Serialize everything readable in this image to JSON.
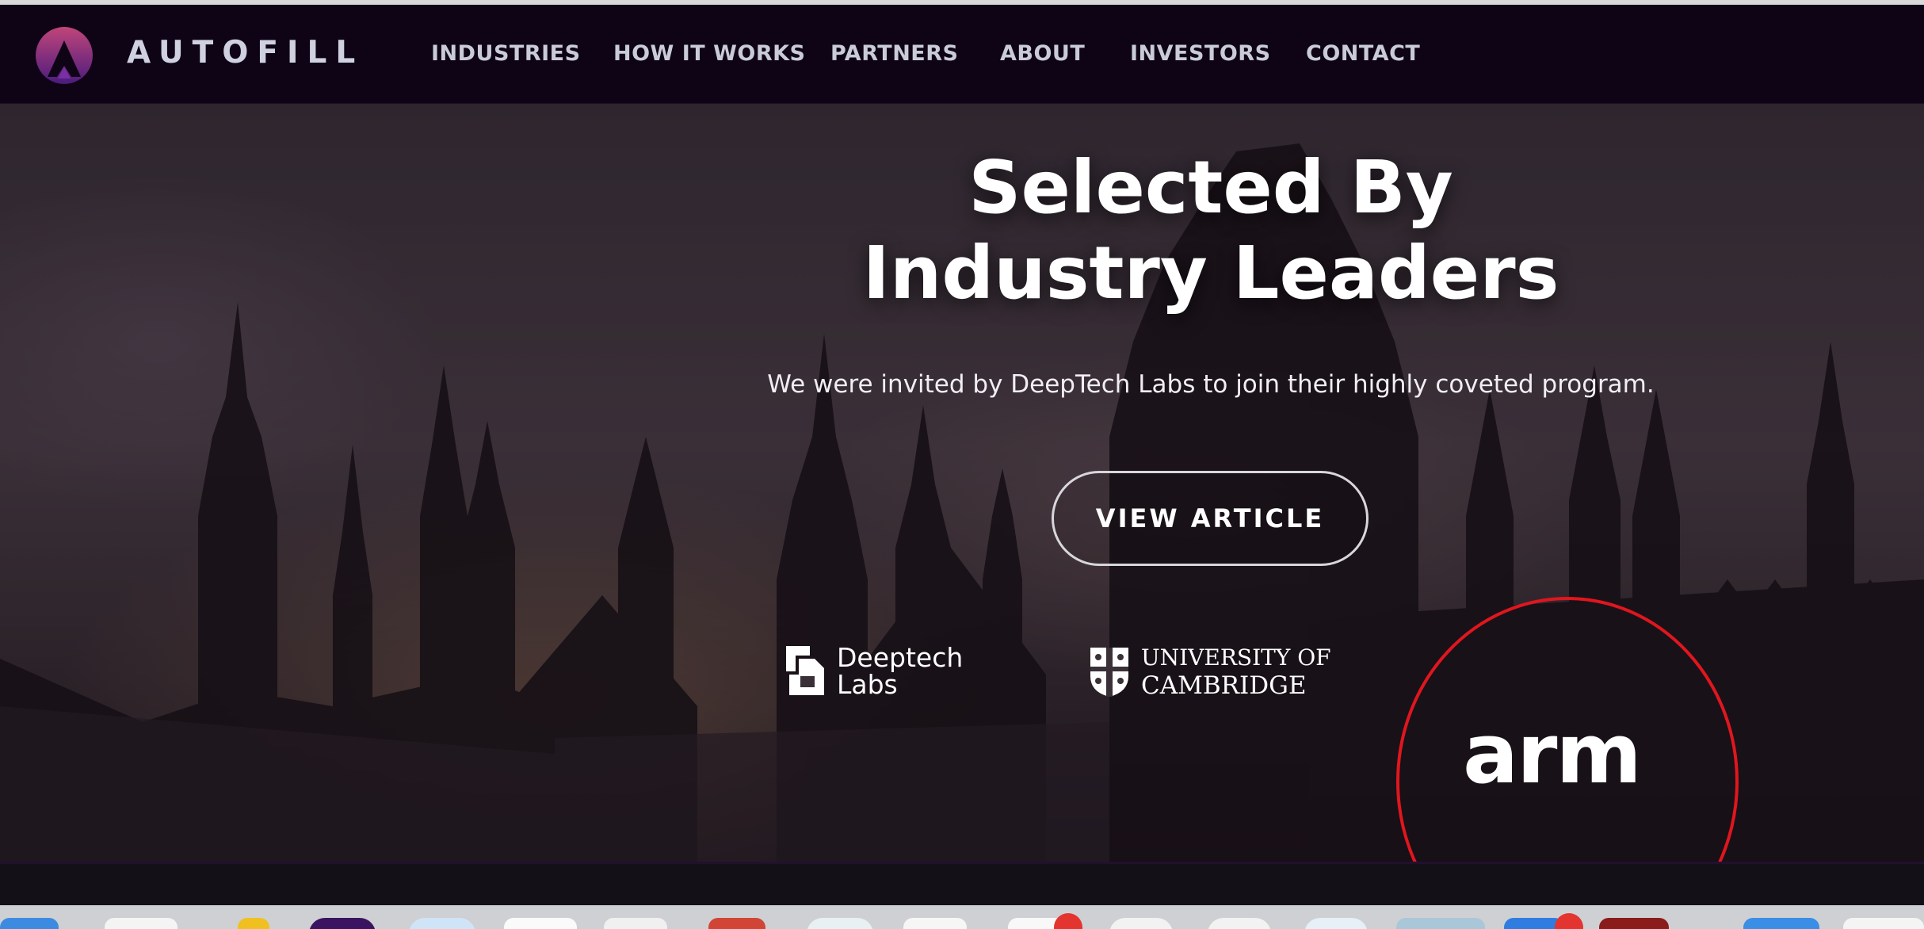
{
  "nav": {
    "logo_text": "AUTOFILL",
    "items": [
      {
        "label": "INDUSTRIES"
      },
      {
        "label": "HOW IT WORKS"
      },
      {
        "label": "PARTNERS"
      },
      {
        "label": "ABOUT"
      },
      {
        "label": "INVESTORS"
      },
      {
        "label": "CONTACT"
      }
    ]
  },
  "hero": {
    "title_line1": "Selected By",
    "title_line2": "Industry Leaders",
    "subtitle": "We were invited by DeepTech Labs to join their highly coveted program.",
    "button_label": "VIEW ARTICLE"
  },
  "partners": {
    "deeptech": {
      "line1": "Deeptech",
      "line2": "Labs"
    },
    "cambridge": {
      "line1": "UNIVERSITY OF",
      "line2": "CAMBRIDGE"
    },
    "arm": {
      "text": "arm"
    }
  },
  "colors": {
    "nav_bg": "#0f0416",
    "highlight": "#e0161e",
    "logo_gradient_top": "#b3416f",
    "logo_gradient_bottom": "#4a1b7a"
  }
}
